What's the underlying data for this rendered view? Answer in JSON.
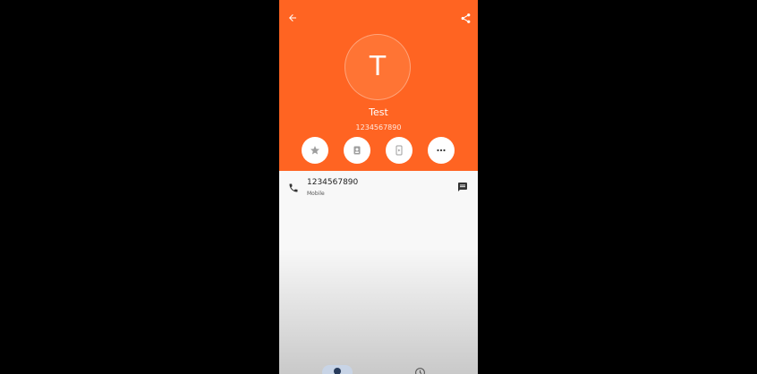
{
  "contact": {
    "initial": "T",
    "name": "Test",
    "number": "1234567890"
  },
  "phone_entry": {
    "number": "1234567890",
    "type": "Mobile"
  },
  "icons": {
    "back": "arrow-back-icon",
    "share": "share-icon",
    "favorite": "star-icon",
    "contact_card": "contact-card-icon",
    "device": "phone-device-icon",
    "more": "more-horizontal-icon",
    "call": "phone-icon",
    "message": "message-icon",
    "contacts_tab": "contacts-tab-icon",
    "recents_tab": "recents-clock-icon"
  },
  "colors": {
    "accent": "#ff6422",
    "avatar": "#ff7434",
    "nav_active": "#c8d4e6"
  }
}
